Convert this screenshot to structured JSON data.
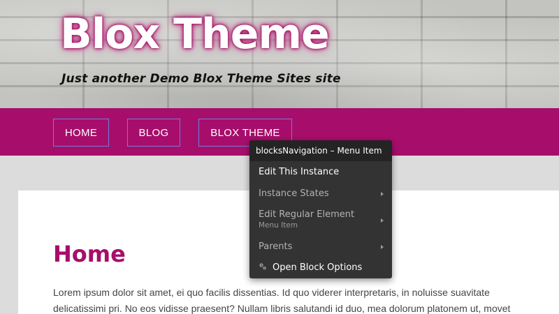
{
  "header": {
    "site_title": "Blox Theme",
    "tagline": "Just another Demo Blox Theme Sites site"
  },
  "nav": {
    "items": [
      {
        "label": "HOME"
      },
      {
        "label": "BLOG"
      },
      {
        "label": "BLOX THEME"
      }
    ]
  },
  "page": {
    "heading": "Home",
    "paragraph": "Lorem ipsum dolor sit amet, ei quo facilis dissentias. Id quo viderer interpretaris, in noluisse suavitate delicatissimi pri. No eos vidisse praesent? Nullam libris salutandi id duo, mea dolorum platonem ut, movet"
  },
  "context_menu": {
    "title": "blocksNavigation – Menu Item",
    "items": [
      {
        "label": "Edit This Instance"
      },
      {
        "label": "Instance States"
      },
      {
        "label": "Edit Regular Element",
        "sublabel": "Menu Item"
      },
      {
        "label": "Parents"
      },
      {
        "label": "Open Block Options",
        "icon": "gear-icon"
      }
    ]
  },
  "colors": {
    "brand": "#a70e6b",
    "nav_border": "#6f7fe0",
    "menu_bg": "#333333"
  }
}
